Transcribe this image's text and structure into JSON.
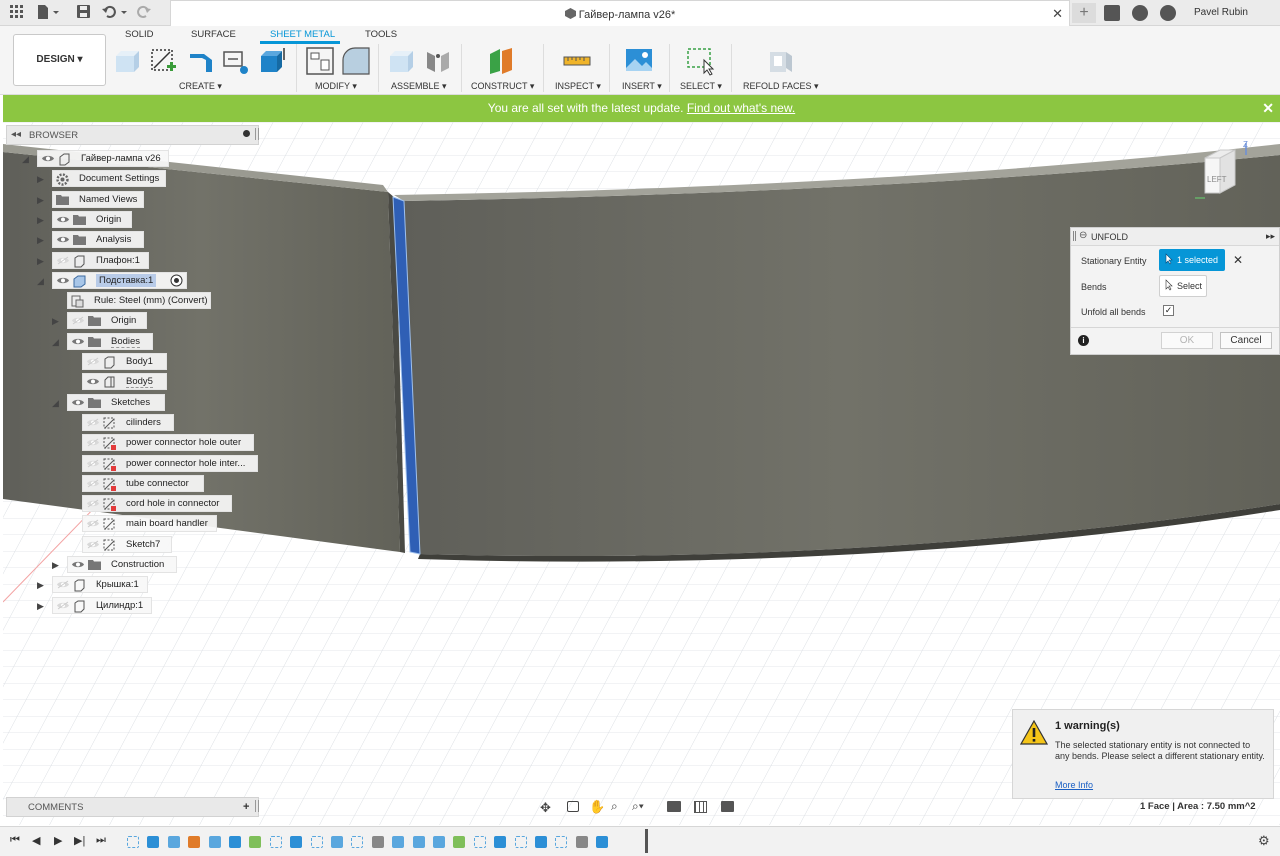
{
  "window": {
    "title": "Гайвер-лампа v26*",
    "user": "Pavel Rubin"
  },
  "workspace": {
    "label": "DESIGN"
  },
  "tabs": [
    {
      "label": "SOLID"
    },
    {
      "label": "SURFACE"
    },
    {
      "label": "SHEET METAL",
      "active": true
    },
    {
      "label": "TOOLS"
    }
  ],
  "toolbar_groups": [
    "CREATE",
    "MODIFY",
    "ASSEMBLE",
    "CONSTRUCT",
    "INSPECT",
    "INSERT",
    "SELECT",
    "REFOLD FACES"
  ],
  "banner": {
    "text": "You are all set with the latest update.",
    "link": "Find out what's new."
  },
  "browser": {
    "title": "BROWSER",
    "items": [
      {
        "label": "Гайвер-лампа v26"
      },
      {
        "label": "Document Settings"
      },
      {
        "label": "Named Views"
      },
      {
        "label": "Origin"
      },
      {
        "label": "Analysis"
      },
      {
        "label": "Плафон:1"
      },
      {
        "label": "Подставка:1"
      },
      {
        "label": "Rule: Steel (mm) (Convert)"
      },
      {
        "label": "Origin"
      },
      {
        "label": "Bodies"
      },
      {
        "label": "Body1"
      },
      {
        "label": "Body5"
      },
      {
        "label": "Sketches"
      },
      {
        "label": "cilinders"
      },
      {
        "label": "power connector hole outer"
      },
      {
        "label": "power connector hole inter..."
      },
      {
        "label": "tube connector"
      },
      {
        "label": "cord hole in connector"
      },
      {
        "label": "main board handler"
      },
      {
        "label": "Sketch7"
      },
      {
        "label": "Construction"
      },
      {
        "label": "Крышка:1"
      },
      {
        "label": "Цилиндр:1"
      }
    ]
  },
  "unfold": {
    "title": "UNFOLD",
    "stationary_label": "Stationary Entity",
    "stationary_value": "1 selected",
    "bends_label": "Bends",
    "bends_value": "Select",
    "unfold_all_label": "Unfold all bends",
    "unfold_all_checked": true,
    "ok": "OK",
    "cancel": "Cancel"
  },
  "viewcube": {
    "face": "LEFT",
    "axis": "Z"
  },
  "warning": {
    "title": "1 warning(s)",
    "body": "The selected stationary entity is not connected to any bends. Please select a different stationary entity.",
    "link": "More Info"
  },
  "comments": {
    "title": "COMMENTS"
  },
  "status": {
    "text": "1 Face | Area : 7.50 mm^2"
  },
  "colors": {
    "accent": "#0696d7",
    "banner": "#8cc641",
    "selected_face": "#2f5fb5",
    "body": "#6f6f68"
  }
}
